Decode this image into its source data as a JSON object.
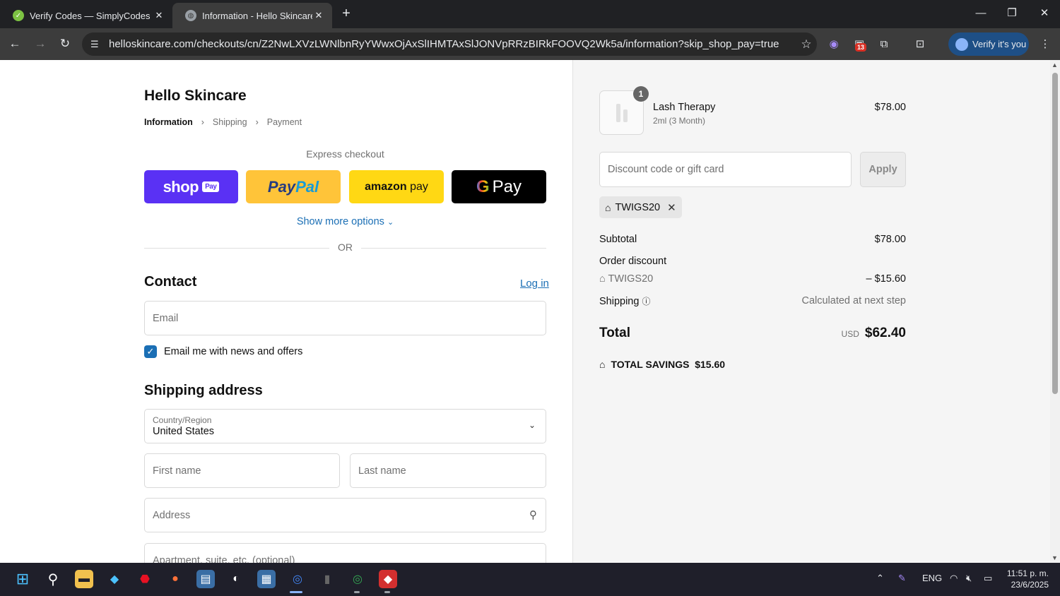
{
  "browser": {
    "tabs": [
      {
        "title": "Verify Codes — SimplyCodes",
        "icon": "simplycodes-icon"
      },
      {
        "title": "Information - Hello Skincare - C",
        "icon": "globe-icon"
      }
    ],
    "url": "helloskincare.com/checkouts/cn/Z2NwLXVzLWNlbnRyYWwxOjAxSlIHMTAxSlJONVpRRzBIRkFOOVQ2Wk5a/information?skip_shop_pay=true",
    "extension_badge": "13",
    "profile_label": "Verify it's you"
  },
  "checkout": {
    "store_name": "Hello Skincare",
    "breadcrumbs": [
      "Information",
      "Shipping",
      "Payment"
    ],
    "express_label": "Express checkout",
    "shop_pay": {
      "text": "shop",
      "tag": "Pay"
    },
    "paypal": {
      "pay": "Pay",
      "pal": "Pal"
    },
    "amazon_pay": {
      "brand": "amazon",
      "pay": "pay"
    },
    "google_pay": {
      "g": "G",
      "pay": "Pay"
    },
    "show_more": "Show more options",
    "or": "OR",
    "contact_heading": "Contact",
    "login_link": "Log in",
    "email_placeholder": "Email",
    "email_news_label": "Email me with news and offers",
    "shipping_heading": "Shipping address",
    "country_label": "Country/Region",
    "country_value": "United States",
    "first_name_placeholder": "First name",
    "last_name_placeholder": "Last name",
    "address_placeholder": "Address",
    "apartment_placeholder": "Apartment, suite, etc. (optional)"
  },
  "summary": {
    "product": {
      "name": "Lash Therapy",
      "variant": "2ml (3 Month)",
      "price": "$78.00",
      "quantity": "1"
    },
    "discount_placeholder": "Discount code or gift card",
    "apply_label": "Apply",
    "applied_code": "TWIGS20",
    "subtotal_label": "Subtotal",
    "subtotal_value": "$78.00",
    "order_discount_label": "Order discount",
    "discount_code": "TWIGS20",
    "discount_value": "– $15.60",
    "shipping_label": "Shipping",
    "shipping_value": "Calculated at next step",
    "total_label": "Total",
    "currency": "USD",
    "total_value": "$62.40",
    "savings_label": "TOTAL SAVINGS",
    "savings_value": "$15.60"
  },
  "taskbar": {
    "lang": "ENG",
    "time": "11:51 p. m.",
    "date": "23/6/2025"
  },
  "colors": {
    "accent_link": "#1b6fb5",
    "shop_pay": "#5a31f4",
    "paypal": "#ffc439",
    "amazon_pay": "#ffd814",
    "google_pay": "#000000"
  }
}
